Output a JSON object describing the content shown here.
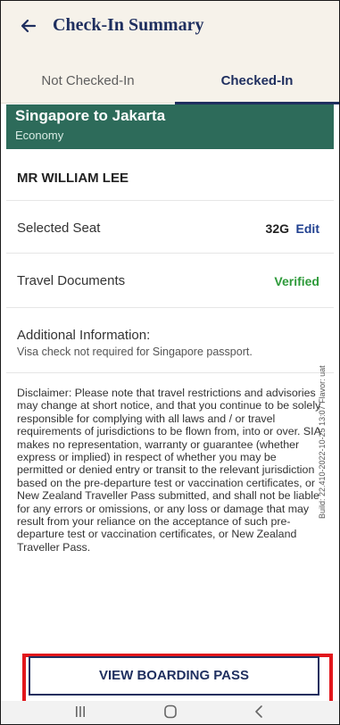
{
  "header": {
    "title": "Check-In Summary"
  },
  "tabs": [
    {
      "label": "Not Checked-In"
    },
    {
      "label": "Checked-In"
    }
  ],
  "flight": {
    "route": "Singapore to Jakarta",
    "cabin": "Economy"
  },
  "passenger": {
    "name": "MR WILLIAM LEE",
    "seat_label": "Selected Seat",
    "seat_value": "32G",
    "edit_label": "Edit",
    "docs_label": "Travel Documents",
    "docs_status": "Verified",
    "addl_title": "Additional Information:",
    "addl_text": "Visa check not required for Singapore passport."
  },
  "disclaimer": "Disclaimer: Please note that travel restrictions and advisories may change at short notice, and that you continue to be solely responsible for complying with all laws and / or travel requirements of jurisdictions to be flown from, into or over. SIA makes no representation, warranty or guarantee (whether express or implied) in respect of whether you may be permitted or denied entry or transit to the relevant jurisdiction based on the pre-departure test or vaccination certificates, or New Zealand Traveller Pass submitted, and shall not be liable for any errors or omissions, or any loss or damage that may result from your reliance on the acceptance of such pre-departure test or vaccination certificates, or New Zealand Traveller Pass.",
  "build_info": "Build: 22.410-2022-10-25 13:07 Flavor: uat",
  "actions": {
    "view_boarding_pass": "VIEW BOARDING PASS"
  },
  "system_nav": {
    "recent_icon": "recent-apps-icon",
    "home_icon": "home-icon",
    "back_icon": "back-icon"
  },
  "colors": {
    "brand_navy": "#1f2f5f",
    "banner_green": "#2d6b5a",
    "verified_green": "#2e9a3a",
    "highlight_red": "#e2171c"
  }
}
